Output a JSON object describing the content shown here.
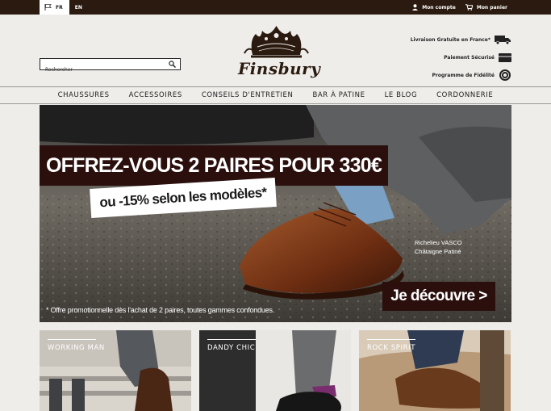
{
  "topbar": {
    "lang_current": "FR",
    "lang_other": "EN",
    "account_label": "Mon compte",
    "cart_label": "Mon panier"
  },
  "header": {
    "search_placeholder": "Rechercher",
    "brand": "Finsbury",
    "perks": [
      {
        "label": "Livraison Gratuite en France*",
        "icon": "truck-icon"
      },
      {
        "label": "Paiement Sécurisé",
        "icon": "card-icon"
      },
      {
        "label": "Programme de Fidélité",
        "icon": "loyalty-badge-icon"
      }
    ]
  },
  "nav": {
    "items": [
      "CHAUSSURES",
      "ACCESSOIRES",
      "CONSEILS D'ENTRETIEN",
      "BAR À PATINE",
      "LE BLOG",
      "CORDONNERIE"
    ]
  },
  "hero": {
    "title": "OFFREZ-VOUS 2 PAIRES POUR 330€",
    "subtitle": "ou -15% selon les modèles*",
    "caption_line1": "Richelieu VASCO",
    "caption_line2": "Châtaigne Patiné",
    "cta": "Je découvre >",
    "disclaimer": "* Offre promotionnelle dès l'achat de 2 paires, toutes gammes confondues."
  },
  "tiles": [
    {
      "label": "WORKING MAN"
    },
    {
      "label": "DANDY CHIC"
    },
    {
      "label": "ROCK SPIRIT"
    }
  ],
  "colors": {
    "topbar_bg": "#2a1a0f",
    "page_bg": "#efedea",
    "promo_bg": "#2a0f0d"
  }
}
